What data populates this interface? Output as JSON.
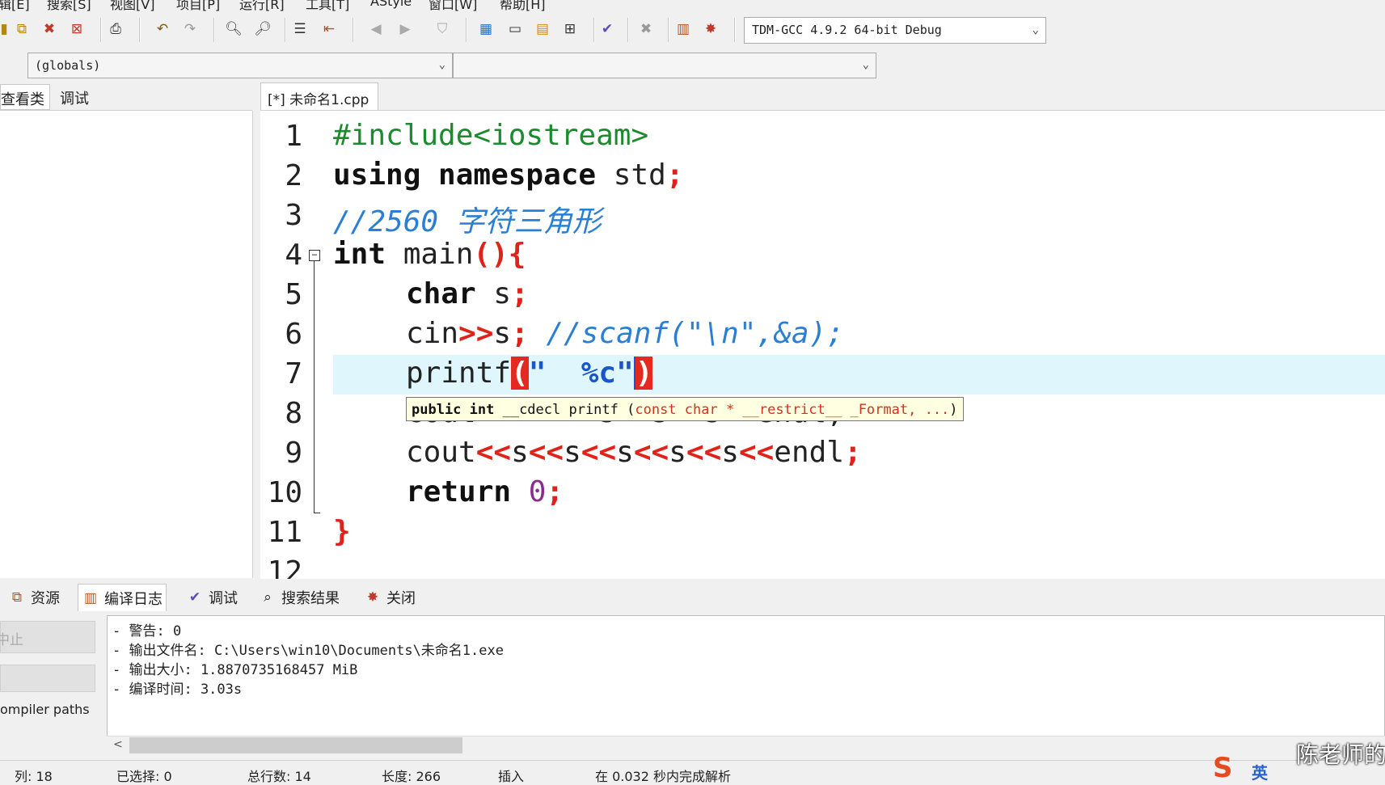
{
  "menu": [
    "辑[E]",
    "搜索[S]",
    "视图[V]",
    "项目[P]",
    "运行[R]",
    "工具[T]",
    "AStyle",
    "窗口[W]",
    "帮助[H]"
  ],
  "toolbar": {
    "compiler": "TDM-GCC 4.9.2 64-bit Debug"
  },
  "scope": {
    "globals": "(globals)",
    "member": ""
  },
  "left_tabs": [
    "查看类",
    "调试"
  ],
  "editor": {
    "tab_label": "[*] 未命名1.cpp",
    "line_numbers": [
      "1",
      "2",
      "3",
      "4",
      "5",
      "6",
      "7",
      "8",
      "9",
      "10",
      "11",
      "12"
    ],
    "lines": {
      "l1": "#include<iostream>",
      "l2_kw": "using namespace",
      "l2_rest": " std",
      "l2_op": ";",
      "l3": "//2560 字符三角形",
      "l4_kw": "int",
      "l4_rest": " main",
      "l4_op": "(){",
      "l5_kw": "char",
      "l5_rest": " s",
      "l5_op": ";",
      "l6_a": "cin",
      "l6_op": ">>",
      "l6_b": "s",
      "l6_semi": ";",
      "l6_cm": " //scanf(\"\\n\",&a);",
      "l7_a": "printf",
      "l7_open": "(",
      "l7_str": "\"  %c\"",
      "l7_close": ")",
      "l8": "cout<<\" \"<<s<<s<<s<<endl;",
      "l9_a": "cout",
      "l9_b": "s",
      "l9_c": "endl",
      "l9_op": "<<",
      "l9_semi": ";",
      "l10_kw": "return",
      "l10_num": "0",
      "l10_op": ";",
      "l11": "}"
    },
    "tooltip": {
      "bold": "public int",
      "plain": " __cdecl printf (",
      "params": "const char * __restrict__ _Format, ...",
      "close": ")"
    }
  },
  "bottom_tabs": [
    "资源",
    "编译日志",
    "调试",
    "搜索结果",
    "关闭"
  ],
  "bottom_left": {
    "abort": "中止",
    "compiler_paths": "ompiler paths"
  },
  "log": [
    "- 警告: 0",
    "- 输出文件名: C:\\Users\\win10\\Documents\\未命名1.exe",
    "- 输出大小: 1.8870735168457 MiB",
    "- 编译时间: 3.03s"
  ],
  "status": {
    "col": "列:  18",
    "selected": "已选择:  0",
    "total_lines": "总行数:  14",
    "length": "长度:  266",
    "insert": "插入",
    "parse": "在 0.032 秒内完成解析"
  },
  "watermark": "陈老师的",
  "ime": "英"
}
